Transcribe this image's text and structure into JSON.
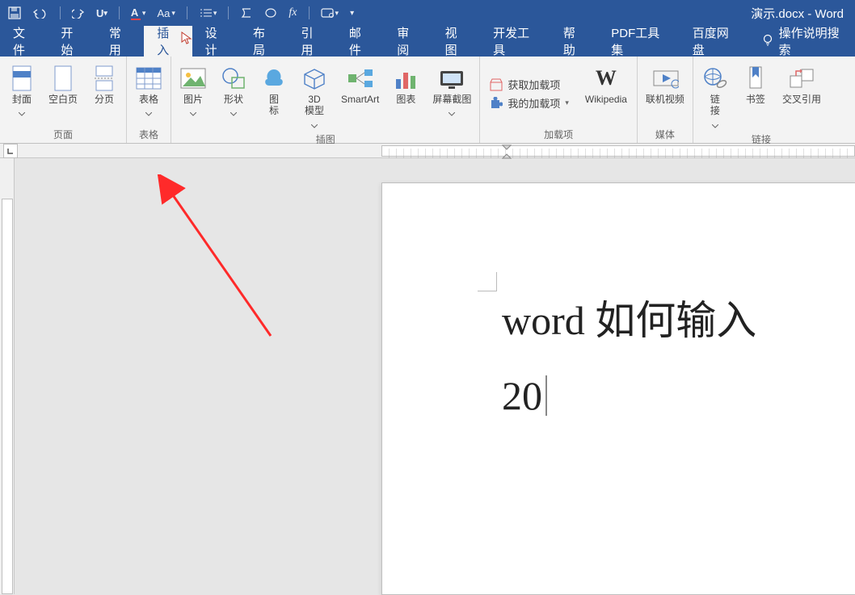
{
  "title": "演示.docx - Word",
  "tabs": {
    "file": "文件",
    "home": "开始",
    "commonuse": "常用",
    "insert": "插入",
    "design": "设计",
    "layout": "布局",
    "references": "引用",
    "mailings": "邮件",
    "review": "审阅",
    "view": "视图",
    "developer": "开发工具",
    "help": "帮助",
    "pdftools": "PDF工具集",
    "baidudisk": "百度网盘",
    "tellme": "操作说明搜索"
  },
  "ribbon": {
    "pages": {
      "label": "页面",
      "cover": "封面",
      "blank": "空白页",
      "break": "分页"
    },
    "tables": {
      "label": "表格",
      "button": "表格"
    },
    "illustrations": {
      "label": "插图",
      "picture": "图片",
      "shapes": "形状",
      "icons_l1": "图",
      "icons_l2": "标",
      "model_l1": "3D",
      "model_l2": "模型",
      "smartart": "SmartArt",
      "chart": "图表",
      "screenshot": "屏幕截图"
    },
    "addins": {
      "label": "加载项",
      "get": "获取加载项",
      "my": "我的加载项",
      "wikipedia": "Wikipedia"
    },
    "media": {
      "label": "媒体",
      "video": "联机视频"
    },
    "links": {
      "label": "链接",
      "hyperlink_l1": "链",
      "hyperlink_l2": "接",
      "bookmark": "书签",
      "crossref": "交叉引用"
    }
  },
  "document": {
    "line1": "word 如何输入",
    "line2": "20"
  }
}
